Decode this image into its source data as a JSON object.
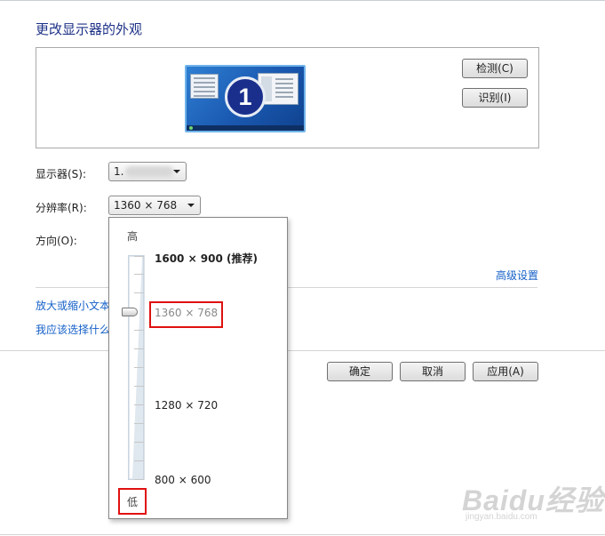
{
  "page": {
    "title": "更改显示器的外观"
  },
  "preview": {
    "monitor_number": "1"
  },
  "buttons": {
    "detect": "检测(C)",
    "identify": "识别(I)",
    "ok": "确定",
    "cancel": "取消",
    "apply": "应用(A)"
  },
  "fields": {
    "display_label": "显示器(S):",
    "display_value": "1.",
    "resolution_label": "分辨率(R):",
    "resolution_value": "1360 × 768",
    "orientation_label": "方向(O):"
  },
  "links": {
    "advanced": "高级设置",
    "zoom_text": "放大或缩小文本",
    "choose": "我应该选择什么"
  },
  "resolution_popup": {
    "high_label": "高",
    "low_label": "低",
    "options": [
      "1600 × 900 (推荐)",
      "1360 × 768",
      "1280 × 720",
      "800 × 600"
    ],
    "selected_index": 1,
    "selected_fraction_from_top": 0.25
  },
  "watermark": {
    "brand": "Baidu经验",
    "url": "jingyan.baidu.com"
  },
  "colors": {
    "title": "#1e3287",
    "link": "#1560c8",
    "highlight_box": "#e01010",
    "monitor": "#1a58b0"
  },
  "icons": [
    "monitor-preview-icon",
    "dropdown-arrow-icon",
    "slider-thumb-icon"
  ]
}
